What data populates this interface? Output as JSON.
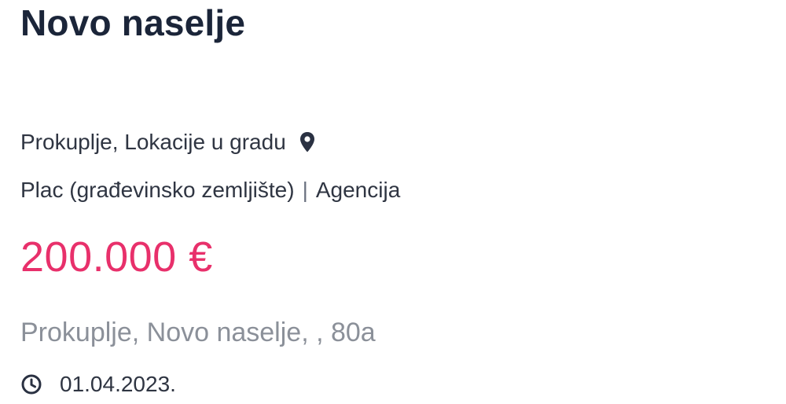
{
  "listing": {
    "title": "Novo naselje",
    "location": "Prokuplje, Lokacije u gradu",
    "location_icon": "map-pin-icon",
    "property_type": "Plac (građevinsko zemljište)",
    "separator": "|",
    "seller_type": "Agencija",
    "price": "200.000 €",
    "address": "Prokuplje, Novo naselje, , 80a",
    "date_icon": "clock-icon",
    "date": "01.04.2023."
  },
  "colors": {
    "title": "#1b2539",
    "text": "#2f3542",
    "price": "#e8306b",
    "address": "#8b9099",
    "icon": "#2a3142"
  }
}
